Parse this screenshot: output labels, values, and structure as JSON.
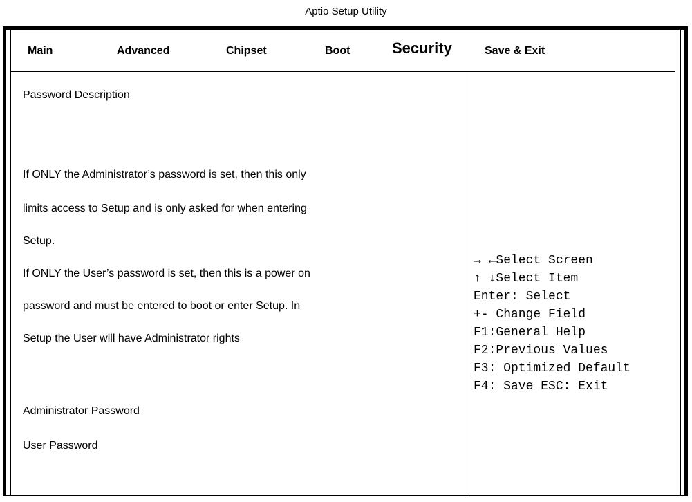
{
  "app": {
    "title": "Aptio Setup Utility"
  },
  "tabs": [
    {
      "label": "Main",
      "active": false
    },
    {
      "label": "Advanced",
      "active": false
    },
    {
      "label": "Chipset",
      "active": false
    },
    {
      "label": "Boot",
      "active": false
    },
    {
      "label": "Security",
      "active": true
    },
    {
      "label": "Save & Exit",
      "active": false
    }
  ],
  "description": {
    "heading": "Password Description",
    "lines": [
      "If ONLY the Administrator’s password is set, then this only",
      "limits access to Setup and is only asked for when entering",
      "Setup.",
      "If ONLY the User’s password is set, then this is a power on",
      "password and must be entered to boot or enter Setup. In",
      "Setup the User will have Administrator rights"
    ]
  },
  "items": [
    {
      "label": "Administrator Password"
    },
    {
      "label": "User Password"
    }
  ],
  "help": {
    "lines": [
      "→ ←Select Screen",
      "↑ ↓Select Item",
      "Enter: Select",
      "+- Change Field",
      "F1:General Help",
      "F2:Previous Values",
      "F3: Optimized Default",
      "F4: Save  ESC: Exit"
    ]
  }
}
